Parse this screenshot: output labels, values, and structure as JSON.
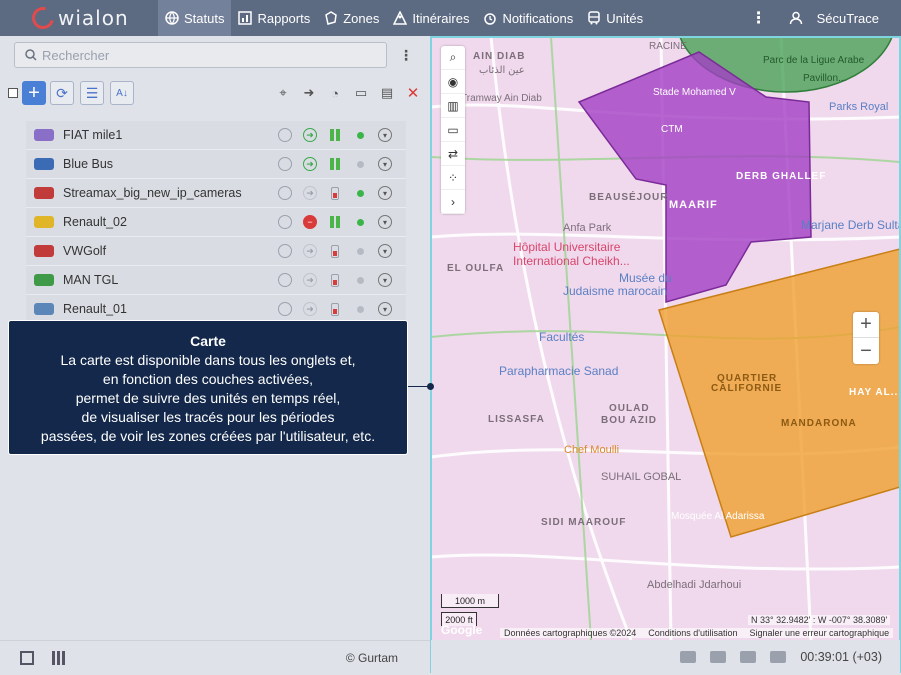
{
  "app": {
    "logo_text": "wialon",
    "user": "SécuTrace"
  },
  "nav": [
    {
      "label": "Statuts",
      "icon": "globe-icon",
      "active": true
    },
    {
      "label": "Rapports",
      "icon": "report-icon"
    },
    {
      "label": "Zones",
      "icon": "zones-icon"
    },
    {
      "label": "Itinéraires",
      "icon": "route-icon"
    },
    {
      "label": "Notifications",
      "icon": "alarm-icon"
    },
    {
      "label": "Unités",
      "icon": "bus-icon"
    }
  ],
  "search": {
    "placeholder": "Rechercher"
  },
  "units": [
    {
      "name": "FIAT mile1",
      "color": "#8a6fc8",
      "motion": "green-arrow",
      "online": true
    },
    {
      "name": "Blue Bus",
      "color": "#3c6bb6",
      "motion": "green-arrow",
      "online": false
    },
    {
      "name": "Streamax_big_new_ip_cameras",
      "color": "#c23b3b",
      "motion": "none",
      "online": true
    },
    {
      "name": "Renault_02",
      "color": "#e0b528",
      "motion": "red-stop",
      "online": true
    },
    {
      "name": "VWGolf",
      "color": "#c23b3b",
      "motion": "none",
      "online": false
    },
    {
      "name": "MAN TGL",
      "color": "#3f9a48",
      "motion": "none",
      "online": false
    },
    {
      "name": "Renault_01",
      "color": "#5a86b8",
      "motion": "none",
      "online": false
    }
  ],
  "tooltip": {
    "title": "Carte",
    "lines": [
      "La carte est disponible dans tous les onglets et,",
      "en fonction des couches activées,",
      "permet de suivre des unités en temps réel,",
      "de visualiser les tracés pour les périodes",
      "passées, de voir les zones créées par l'utilisateur, etc."
    ]
  },
  "map": {
    "scale_m": "1000 m",
    "scale_ft": "2000 ft",
    "attribution": [
      "Données cartographiques ©2024",
      "Conditions d'utilisation",
      "Signaler une erreur cartographique"
    ],
    "coords": "N 33° 32.9482' : W -007° 38.3089'",
    "labels": [
      {
        "text": "RACINE"
      },
      {
        "text": "AIN DIAB"
      },
      {
        "text": "عين الذئاب"
      },
      {
        "text": "Stade Mohamed V"
      },
      {
        "text": "Tramway Ain Diab"
      },
      {
        "text": "Parc de la Ligue Arabe"
      },
      {
        "text": "Pavillon..."
      },
      {
        "text": "Parks Royal"
      },
      {
        "text": "CTM"
      },
      {
        "text": "DERB GHALLEF"
      },
      {
        "text": "BEAUSÉJOUR"
      },
      {
        "text": "MAARIF"
      },
      {
        "text": "Anfa Park"
      },
      {
        "text": "Hôpital Universitaire"
      },
      {
        "text": "International Cheikh..."
      },
      {
        "text": "EL OULFA"
      },
      {
        "text": "Musée du"
      },
      {
        "text": "Judaisme marocain"
      },
      {
        "text": "Marjane Derb Sultan"
      },
      {
        "text": "Facultés"
      },
      {
        "text": "Parapharmacie Sanad"
      },
      {
        "text": "QUARTIER"
      },
      {
        "text": "CALIFORNIE"
      },
      {
        "text": "OULAD"
      },
      {
        "text": "BOU AZID"
      },
      {
        "text": "LISSASFA"
      },
      {
        "text": "MANDARONA"
      },
      {
        "text": "HAY AL..."
      },
      {
        "text": "Chef Moulli"
      },
      {
        "text": "SUHAIL GOBAL"
      },
      {
        "text": "SIDI MAAROUF"
      },
      {
        "text": "Mosquée Al Adarissa"
      },
      {
        "text": "Abdelhadi Jdarhoui"
      },
      {
        "text": "Google"
      }
    ]
  },
  "footer": {
    "copyright": "© Gurtam",
    "time": "00:39:01 (+03)"
  },
  "colors": {
    "topbar": "#5c6a82",
    "zone_purple": "#a23fc4",
    "zone_orange": "#f0a030",
    "zone_green": "#3f9e4d",
    "tooltip_bg": "#13284a"
  }
}
